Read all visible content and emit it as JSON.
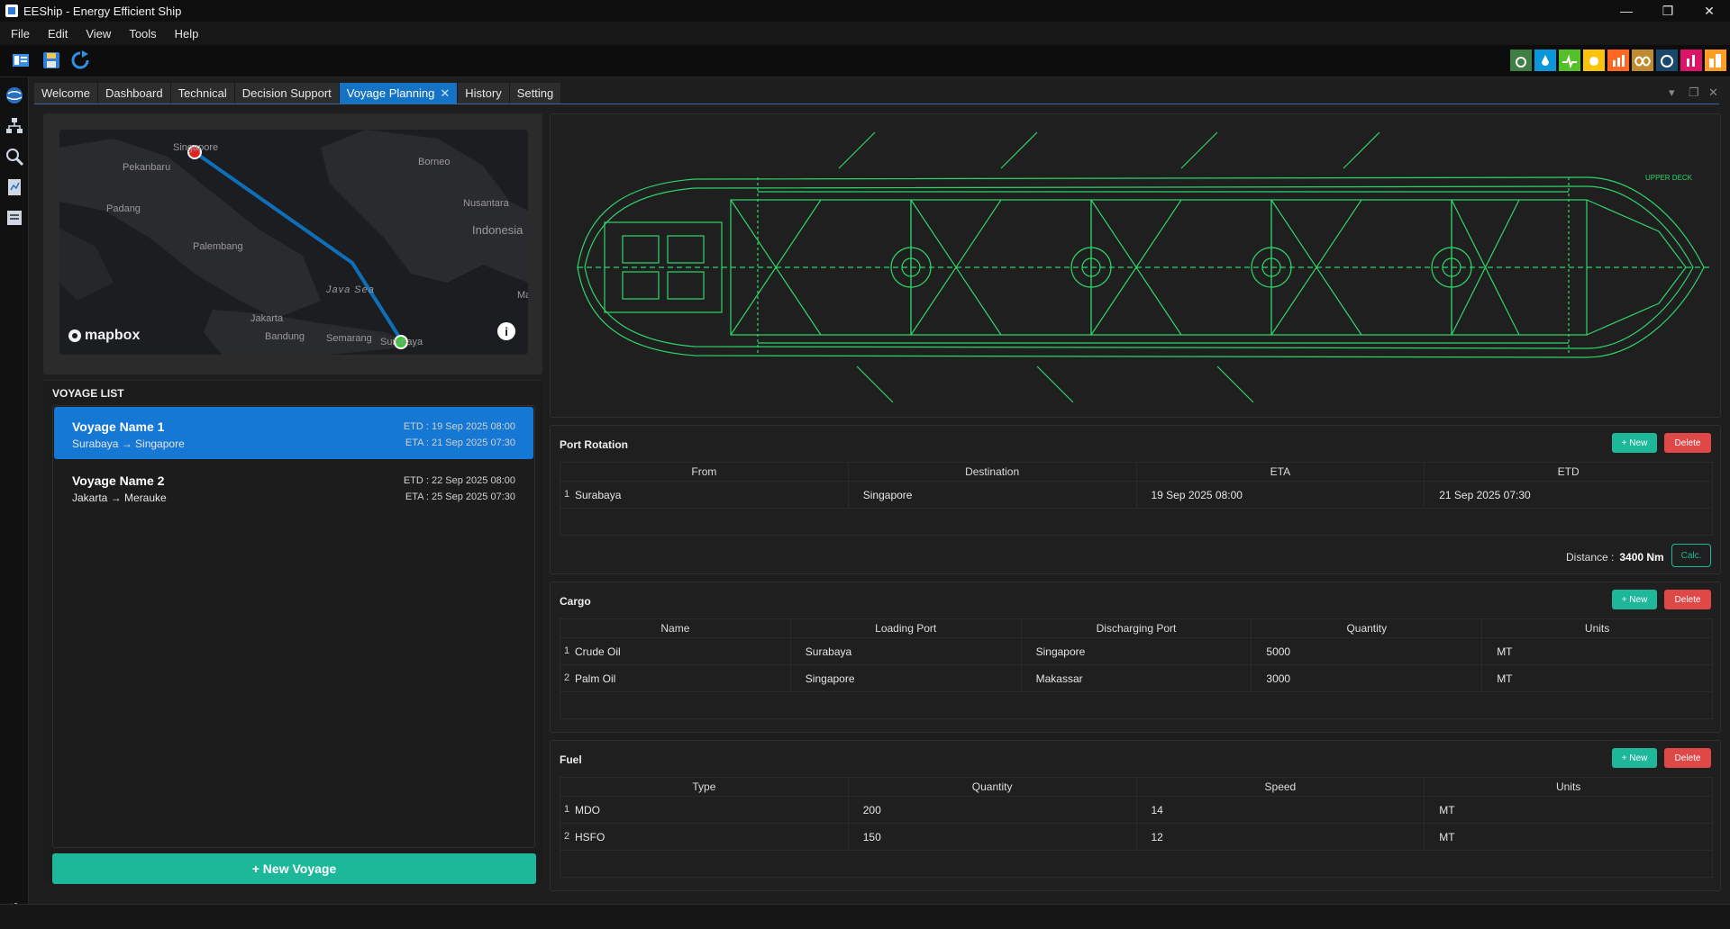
{
  "window": {
    "title": "EEShip - Energy Efficient Ship"
  },
  "menu": [
    "File",
    "Edit",
    "View",
    "Tools",
    "Help"
  ],
  "toolbar": {
    "icons": [
      "panel-icon",
      "save-icon",
      "refresh-icon"
    ]
  },
  "sdg_icons": [
    {
      "color": "#3f7e44"
    },
    {
      "color": "#0a97d9"
    },
    {
      "color": "#56c02b"
    },
    {
      "color": "#fcc30b"
    },
    {
      "color": "#fd6925"
    },
    {
      "color": "#bf8b2e"
    },
    {
      "color": "#19486a"
    },
    {
      "color": "#dd1367"
    },
    {
      "color": "#fd9d24"
    }
  ],
  "tabs": [
    {
      "label": "Welcome"
    },
    {
      "label": "Dashboard"
    },
    {
      "label": "Technical"
    },
    {
      "label": "Decision Support"
    },
    {
      "label": "Voyage Planning",
      "active": true
    },
    {
      "label": "History"
    },
    {
      "label": "Setting"
    }
  ],
  "map": {
    "labels": {
      "singapore": "Singapore",
      "pekanbaru": "Pekanbaru",
      "padang": "Padang",
      "palembang": "Palembang",
      "borneo": "Borneo",
      "nusantara": "Nusantara",
      "indonesia": "Indonesia",
      "java_sea": "Java Sea",
      "jakarta": "Jakarta",
      "bandung": "Bandung",
      "semarang": "Semarang",
      "surabaya": "Surabaya",
      "ma": "Ma"
    },
    "attribution": "mapbox",
    "info": "i",
    "start_color": "#e32222",
    "end_color": "#2ecc2e",
    "route_color": "#0e6fb8"
  },
  "voyage_list": {
    "title": "VOYAGE LIST",
    "items": [
      {
        "name": "Voyage Name 1",
        "route": "Surabaya → Singapore",
        "etd": "ETD : 19 Sep 2025 08:00",
        "eta": "ETA : 21 Sep 2025 07:30",
        "selected": true
      },
      {
        "name": "Voyage Name 2",
        "route": "Jakarta → Merauke",
        "etd": "ETD : 22 Sep 2025 08:00",
        "eta": "ETA : 25 Sep 2025 07:30",
        "selected": false
      }
    ],
    "new_button": "+ New Voyage"
  },
  "ship": {
    "label": "UPPER DECK",
    "line_color": "#2fd46a"
  },
  "port_rotation": {
    "title": "Port Rotation",
    "new": "+ New",
    "delete": "Delete",
    "columns": [
      "From",
      "Destination",
      "ETA",
      "ETD"
    ],
    "rows": [
      {
        "n": "1",
        "cells": [
          "Surabaya",
          "Singapore",
          "19 Sep 2025 08:00",
          "21 Sep 2025 07:30"
        ]
      }
    ],
    "distance_label": "Distance :",
    "distance_value": "3400 Nm",
    "calc": "Calc."
  },
  "cargo": {
    "title": "Cargo",
    "new": "+ New",
    "delete": "Delete",
    "columns": [
      "Name",
      "Loading Port",
      "Discharging Port",
      "Quantity",
      "Units"
    ],
    "rows": [
      {
        "n": "1",
        "cells": [
          "Crude Oil",
          "Surabaya",
          "Singapore",
          "5000",
          "MT"
        ]
      },
      {
        "n": "2",
        "cells": [
          "Palm Oil",
          "Singapore",
          "Makassar",
          "3000",
          "MT"
        ]
      }
    ]
  },
  "fuel": {
    "title": "Fuel",
    "new": "+ New",
    "delete": "Delete",
    "columns": [
      "Type",
      "Quantity",
      "Speed",
      "Units"
    ],
    "rows": [
      {
        "n": "1",
        "cells": [
          "MDO",
          "200",
          "14",
          "MT"
        ]
      },
      {
        "n": "2",
        "cells": [
          "HSFO",
          "150",
          "12",
          "MT"
        ]
      }
    ]
  }
}
